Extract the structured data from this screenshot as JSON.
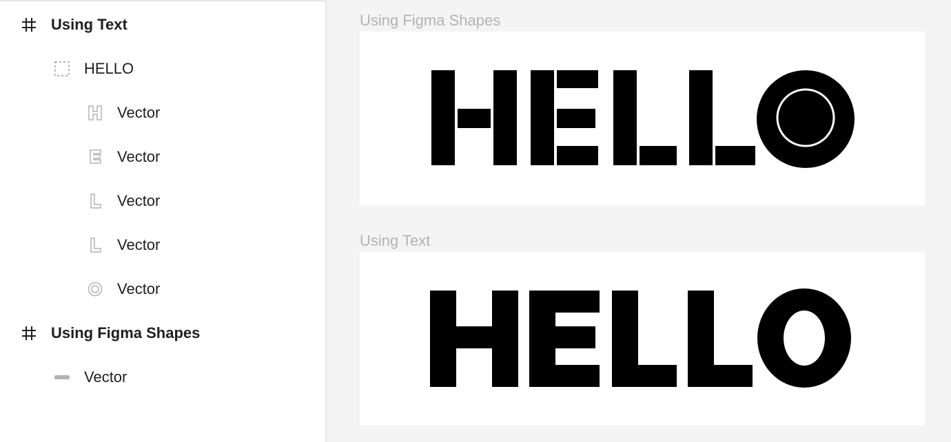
{
  "layers": {
    "frame_text": {
      "label": "Using Text",
      "icon": "frame-icon"
    },
    "text_layer": {
      "label": "HELLO",
      "icon": "text-frame-icon"
    },
    "vectors": [
      {
        "label": "Vector",
        "icon": "letter-h-icon"
      },
      {
        "label": "Vector",
        "icon": "letter-e-icon"
      },
      {
        "label": "Vector",
        "icon": "letter-l-icon"
      },
      {
        "label": "Vector",
        "icon": "letter-l-icon"
      },
      {
        "label": "Vector",
        "icon": "letter-o-icon"
      }
    ],
    "frame_shapes": {
      "label": "Using Figma Shapes",
      "icon": "frame-icon"
    },
    "shape_vector": {
      "label": "Vector",
      "icon": "line-icon"
    }
  },
  "canvas": {
    "frames": [
      {
        "title": "Using Figma Shapes",
        "content": "HELLO"
      },
      {
        "title": "Using Text",
        "content": "HELLO"
      }
    ]
  },
  "colors": {
    "panel_bg": "#ffffff",
    "canvas_bg": "#f4f4f4",
    "icon_gray": "#b3b3b3",
    "text": "#1e1e1e",
    "glyph": "#000000"
  }
}
